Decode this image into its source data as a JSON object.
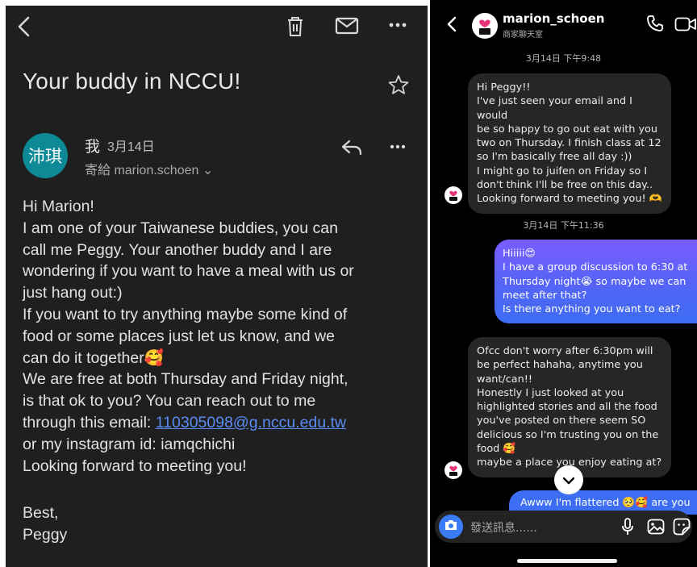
{
  "email": {
    "subject": "Your buddy in NCCU!",
    "avatar_text": "沛琪",
    "sender": "我",
    "date": "3月14日",
    "recipient": "寄給 marion.schoen ⌄",
    "body": {
      "l1": "Hi Marion!",
      "l2": "I am one of your Taiwanese buddies, you can",
      "l3": "call me Peggy. Your another  buddy and I are",
      "l4": "wondering if you want to have a meal with us or",
      "l5": "just hang out:)",
      "l6": "If you want to try anything maybe some kind of",
      "l7": "food or some places just let us know, and we",
      "l8": "can do it together🥰",
      "l9": "We are free at both Thursday and Friday night,",
      "l10": "is that ok to you?  You can reach out to me",
      "l11_prefix": "through this email: ",
      "email_link": "110305098@g.nccu.edu.tw",
      "l12": "or my instagram id: iamqchichi",
      "l13": "Looking forward to meeting you!"
    },
    "signoff": "Best,",
    "signature": "Peggy",
    "icons": [
      "back-icon",
      "trash-icon",
      "mail-icon",
      "more-icon",
      "star-icon",
      "reply-icon"
    ]
  },
  "dm": {
    "username": "marion_schoen",
    "subtitle": "商家聊天室",
    "timestamp1": "3月14日 下午9:48",
    "msg1": {
      "l1": "Hi Peggy!!",
      "l2": "I've just seen your email and I would",
      "l3": "be so happy to go out eat with you",
      "l4": "two on Thursday. I finish class at 12",
      "l5": "so I'm basically free all day :))",
      "l6": "I might go to juifen on Friday so I",
      "l7": "don't think I'll be free on this day..",
      "l8": "Looking forward to meeting you! 🫶"
    },
    "timestamp2": "3月14日 下午11:36",
    "msg2": {
      "l1": "Hiiiii😍",
      "l2": "I have a group discussion to 6:30 at",
      "l3": "Thursday night😭  so maybe we can",
      "l4": "meet after that?",
      "l5": "Is there anything you want to eat?"
    },
    "msg3": {
      "l1": "Ofcc don't worry after 6:30pm will",
      "l2": "be perfect hahaha, anytime you",
      "l3": "want/can!!",
      "l4": "Honestly I just looked at you",
      "l5": "highlighted stories and all the food",
      "l6": "you've posted on there seem SO",
      "l7": "delicious so I'm trusting you on the",
      "l8": "food 🥰",
      "l9": "maybe a place you enjoy eating at?"
    },
    "msg4": "Awww I'm flattered 🥺🥰 are you",
    "composer_placeholder": "發送訊息......",
    "icons": [
      "back-icon",
      "phone-icon",
      "video-icon",
      "camera-icon",
      "mic-icon",
      "gallery-icon",
      "sticker-icon",
      "chevron-down-icon"
    ]
  },
  "colors": {
    "email_bg": "#1f1f1f",
    "avatar": "#0d8a96",
    "link": "#5b8cf4",
    "dm_bg": "#000000",
    "incoming_bubble": "#262626",
    "outgoing_gradient": [
      "#7a5cff",
      "#3d6cf3"
    ],
    "camera_button": "#3a7bf6"
  }
}
